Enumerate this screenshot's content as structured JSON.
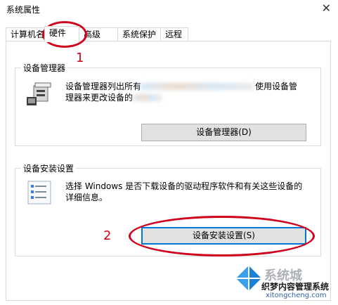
{
  "window": {
    "title": "系统属性",
    "close_glyph": "✕"
  },
  "tabs": [
    {
      "label": "计算机名"
    },
    {
      "label": "硬件"
    },
    {
      "label": "高级"
    },
    {
      "label": "系统保护"
    },
    {
      "label": "远程"
    }
  ],
  "device_manager": {
    "group_label": "设备管理器",
    "description_line1": "设备管理器列出所有",
    "description_line1_end": "使用设备管",
    "description_line2": "理器来更改设备的",
    "button_label": "设备管理器(D)"
  },
  "device_install": {
    "group_label": "设备安装设置",
    "description_line1": "选择 Windows 是否下载设备的驱动程序软件和有关这些设备的",
    "description_line2": "详细信息。",
    "button_label": "设备安装设置(S)"
  },
  "annotations": {
    "step1": "1",
    "step2": "2",
    "color": "#d0021b"
  },
  "watermark": {
    "line1": "系统城",
    "line2": "织梦内容管理系统",
    "line3": "xitongcheng.com"
  }
}
